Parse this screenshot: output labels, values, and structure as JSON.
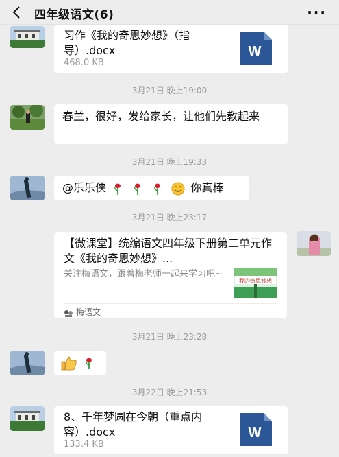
{
  "header": {
    "title": "四年级语文(6)"
  },
  "messages": [
    {
      "type": "file",
      "file_name": "习作《我的奇思妙想》（指导）.docx",
      "file_size": "468.0 KB",
      "file_icon_letter": "W",
      "icon": "word-icon"
    },
    {
      "type": "time",
      "text": "3月21日 晚上19:00"
    },
    {
      "type": "text",
      "text": "春兰，很好，发给家长，让他们先教起来"
    },
    {
      "type": "time",
      "text": "3月21日 晚上19:33"
    },
    {
      "type": "text",
      "text": "@乐乐侠",
      "suffix": "你真棒"
    },
    {
      "type": "time",
      "text": "3月21日 晚上23:17"
    },
    {
      "type": "link",
      "title": "【微课堂】统编语文四年级下册第二单元作文《我的奇思妙想》...",
      "desc": "关注梅语文，跟着梅老师一起来学习吧~",
      "source": "梅语文",
      "thumb_text": "我的奇思妙想"
    },
    {
      "type": "time",
      "text": "3月21日 晚上23:28"
    },
    {
      "type": "emoji",
      "icons": [
        "thumbs-up-icon",
        "rose-icon"
      ]
    },
    {
      "type": "time",
      "text": "3月22日 晚上21:53"
    },
    {
      "type": "file",
      "file_name": "8、千年梦圆在今朝（重点内容）.docx",
      "file_size": "133.4 KB",
      "file_icon_letter": "W",
      "icon": "word-icon"
    }
  ],
  "colors": {
    "background": "#ededed",
    "bubble": "#ffffff",
    "word_blue": "#2b5797",
    "time_gray": "#9a9a9a"
  }
}
